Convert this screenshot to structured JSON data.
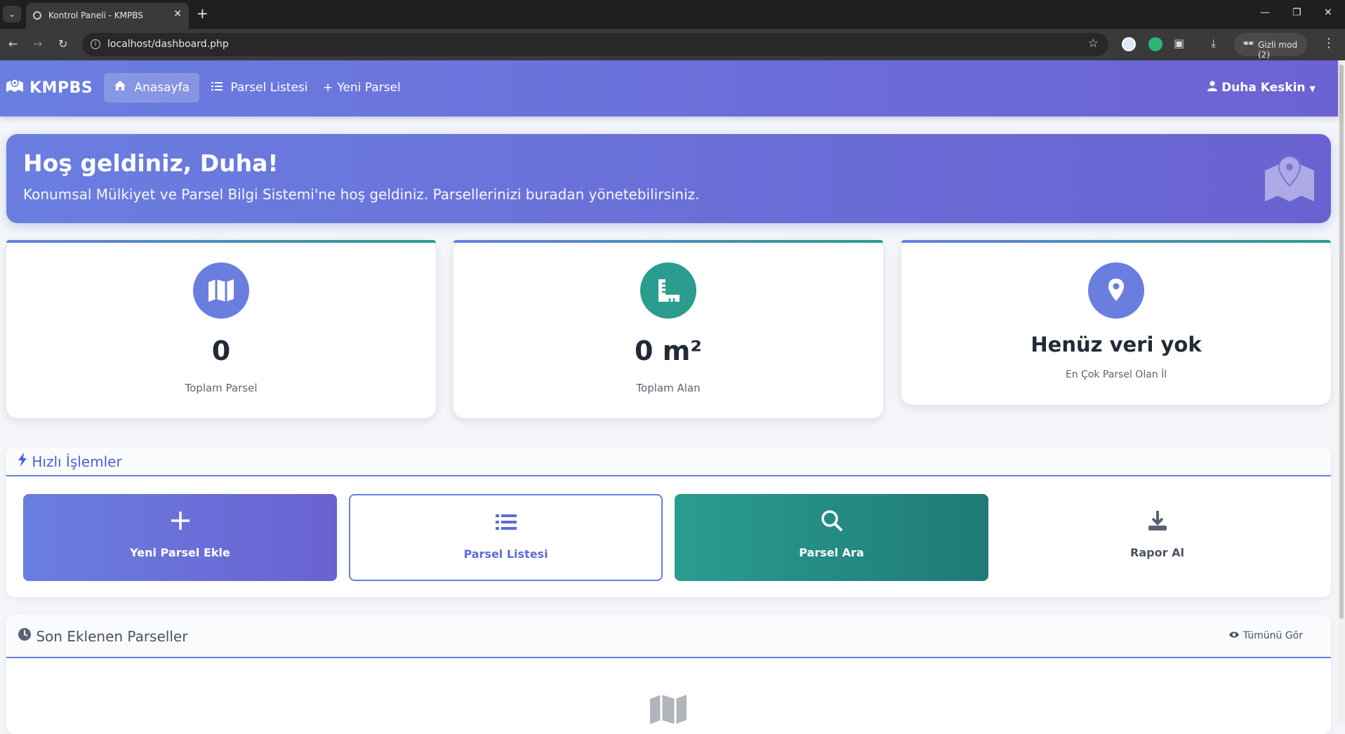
{
  "browser": {
    "tab_title": "Kontrol Paneli - KMPBS",
    "url": "localhost/dashboard.php",
    "incognito_label": "Gizli mod (2)"
  },
  "navbar": {
    "brand": "KMPBS",
    "links": [
      {
        "label": "Anasayfa",
        "icon": "home-icon",
        "active": true
      },
      {
        "label": "Parsel Listesi",
        "icon": "list-icon",
        "active": false
      },
      {
        "label": "Yeni Parsel",
        "icon": "plus-icon",
        "active": false
      }
    ],
    "user": "Duha Keskin"
  },
  "welcome": {
    "title": "Hoş geldiniz, Duha!",
    "subtitle": "Konumsal Mülkiyet ve Parsel Bilgi Sistemi'ne hoş geldiniz. Parsellerinizi buradan yönetebilirsiniz."
  },
  "stats": [
    {
      "value": "0",
      "label": "Toplam Parsel",
      "icon": "map-icon",
      "color": "#6a7ee0"
    },
    {
      "value": "0 m²",
      "label": "Toplam Alan",
      "icon": "ruler-icon",
      "color": "#2a9d8f"
    },
    {
      "value": "Henüz veri yok",
      "label": "En Çok Parsel Olan İl",
      "icon": "location-pin-icon",
      "color": "#6a7ee0"
    }
  ],
  "quick_actions": {
    "title": "Hızlı İşlemler",
    "items": [
      {
        "label": "Yeni Parsel Ekle",
        "icon": "plus-icon"
      },
      {
        "label": "Parsel Listesi",
        "icon": "list-icon"
      },
      {
        "label": "Parsel Ara",
        "icon": "search-icon"
      },
      {
        "label": "Rapor Al",
        "icon": "download-icon"
      }
    ]
  },
  "recent": {
    "title": "Son Eklenen Parseller",
    "see_all": "Tümünü Gör"
  },
  "colors": {
    "primary": "#6a7ee0",
    "teal": "#2a9d8f"
  }
}
